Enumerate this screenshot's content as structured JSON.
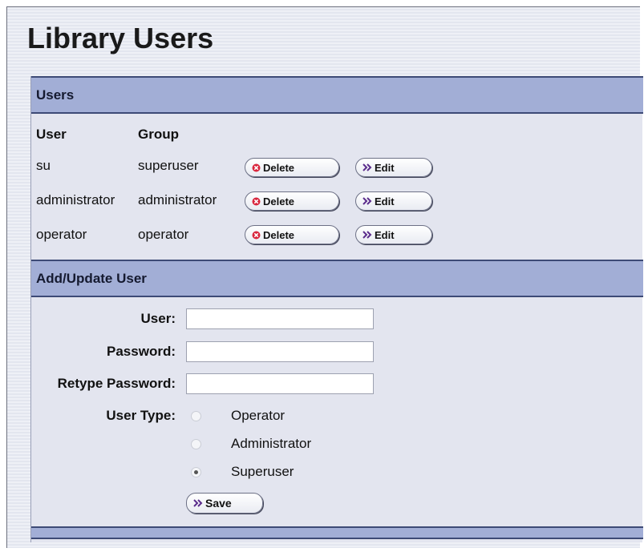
{
  "page": {
    "title": "Library Users"
  },
  "users_section": {
    "header": "Users",
    "columns": {
      "user": "User",
      "group": "Group"
    },
    "rows": [
      {
        "user": "su",
        "group": "superuser"
      },
      {
        "user": "administrator",
        "group": "administrator"
      },
      {
        "user": "operator",
        "group": "operator"
      }
    ],
    "delete_label": "Delete",
    "edit_label": "Edit"
  },
  "add_section": {
    "header": "Add/Update User",
    "user_label": "User:",
    "user_value": "",
    "password_label": "Password:",
    "password_value": "",
    "retype_label": "Retype Password:",
    "retype_value": "",
    "user_type_label": "User Type:",
    "user_types": [
      "Operator",
      "Administrator",
      "Superuser"
    ],
    "selected_user_type": "Superuser",
    "save_label": "Save"
  },
  "icons": {
    "delete": "delete-circle-x-icon",
    "edit": "double-chevron-right-icon",
    "save": "double-chevron-right-icon"
  },
  "colors": {
    "header_bg": "#a2aed6",
    "header_border": "#3d4a76",
    "panel_bg": "#e3e5ef",
    "delete_icon": "#d9263d",
    "chevron_icon": "#5b2d8c"
  }
}
